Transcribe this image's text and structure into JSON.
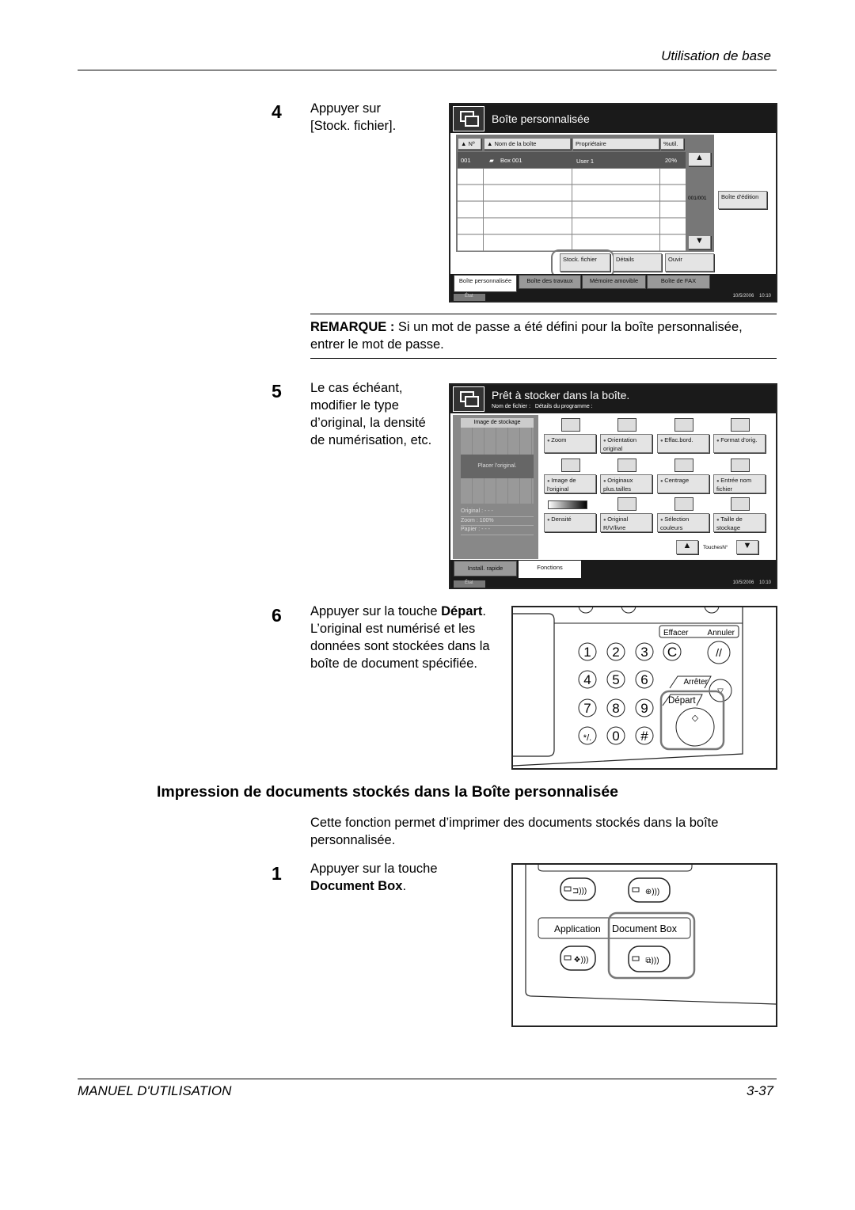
{
  "header": {
    "section": "Utilisation de base"
  },
  "step4": {
    "number": "4",
    "text": "Appuyer sur [Stock. fichier]."
  },
  "screen1": {
    "title": "Boîte personnalisée",
    "columns": [
      "Nº",
      "Nom de la boîte",
      "Propriétaire",
      "%util."
    ],
    "rows": [
      {
        "no": "001",
        "name": "Box 001",
        "owner": "User 1",
        "usage": "20%"
      }
    ],
    "page": "001/001",
    "edit_button": "Boîte d'édition",
    "buttons": [
      "Stock. fichier",
      "Détails",
      "Ouvir"
    ],
    "tabs": [
      "Boîte personnalisée",
      "Boîte des travaux",
      "Mémoire amovible",
      "Boîte de FAX"
    ],
    "status": "État",
    "datetime": "10/5/2006    10:10"
  },
  "note": {
    "label": "REMARQUE :",
    "text": " Si un mot de passe a été défini pour la boîte personnalisée, entrer le mot de passe."
  },
  "step5": {
    "number": "5",
    "text": "Le cas échéant, modifier le type d’original, la densité de numérisation, etc."
  },
  "screen2": {
    "title": "Prêt à stocker dans la boîte.",
    "subtitle": "Nom de fichier :   Détails du programme :",
    "preview_label": "Image de stockage",
    "place_text": "Placer l'original.",
    "info": [
      {
        "k": "Original",
        "v": ": - - -"
      },
      {
        "k": "Zoom",
        "v": ": 100%"
      },
      {
        "k": "Papier",
        "v": ": - - -"
      }
    ],
    "functions": [
      "Zoom",
      "Orientation original",
      "Effac.bord.",
      "Format d'orig.",
      "Image de l'original",
      "Originaux plus.tailles",
      "Centrage",
      "Entrée nom fichier",
      "Densité",
      "Original R/V/livre",
      "Sélection couleurs",
      "Taille de stockage"
    ],
    "keys_label": "TouchesN°",
    "tabs": [
      "Install. rapide",
      "Fonctions"
    ],
    "status": "État",
    "datetime": "10/5/2006    10:10"
  },
  "step6": {
    "number": "6",
    "text_before": "Appuyer sur la touche ",
    "key": "Départ",
    "text_after": ". L’original est numérisé et les données sont stockées dans la boîte de document spécifiée."
  },
  "keypad": {
    "keys": [
      "1",
      "2",
      "3",
      "C",
      "4",
      "5",
      "6",
      "7",
      "8",
      "9",
      "*/.",
      "0",
      "#"
    ],
    "effacer": "Effacer",
    "annuler": "Annuler",
    "arreter": "Arrêter",
    "depart": "Départ"
  },
  "section": {
    "title": "Impression de documents stockés dans la Boîte personnalisée",
    "intro": "Cette fonction permet d’imprimer des documents stockés dans la boîte personnalisée."
  },
  "step1": {
    "number": "1",
    "text": "Appuyer sur la touche ",
    "key": "Document Box",
    "after": "."
  },
  "panel2": {
    "application": "Application",
    "document_box": "Document Box"
  },
  "footer": {
    "manual": "MANUEL D'UTILISATION",
    "page": "3-37"
  }
}
